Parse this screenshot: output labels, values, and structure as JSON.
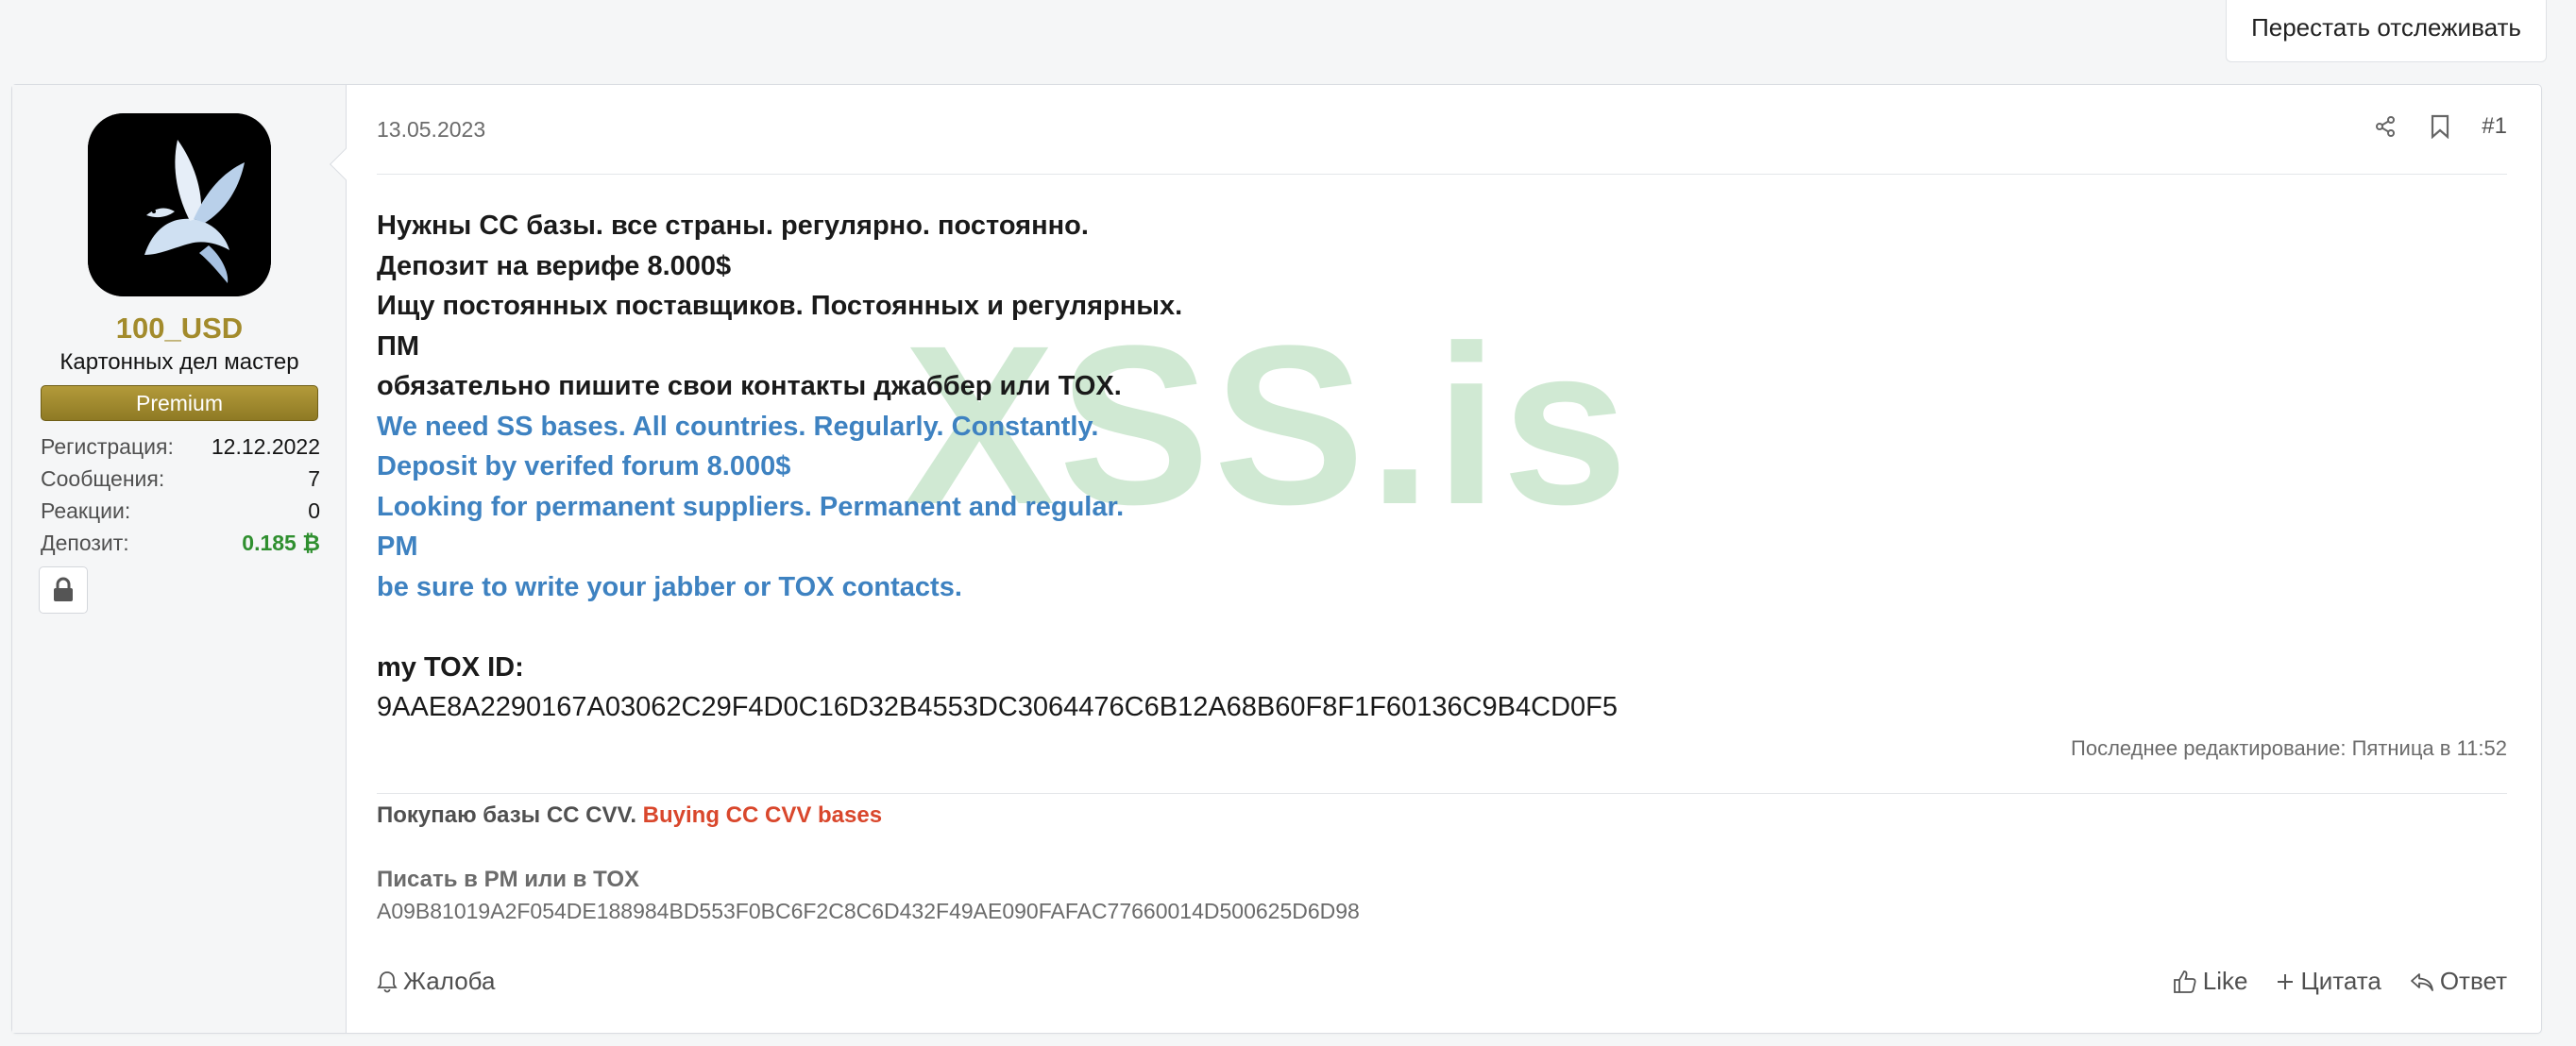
{
  "header": {
    "unwatch_label": "Перестать отслеживать"
  },
  "user": {
    "username": "100_USD",
    "title": "Картонных дел мастер",
    "badge": "Premium",
    "stats": [
      {
        "label": "Регистрация:",
        "value": "12.12.2022"
      },
      {
        "label": "Сообщения:",
        "value": "7"
      },
      {
        "label": "Реакции:",
        "value": "0"
      },
      {
        "label": "Депозит:",
        "value": "0.185 ₿"
      }
    ]
  },
  "post": {
    "date": "13.05.2023",
    "number": "#1",
    "lines_ru": [
      "Нужны СС базы. все страны. регулярно. постоянно.",
      "Депозит на верифе 8.000$",
      "Ищу постоянных поставщиков. Постоянных и регулярных.",
      "ПМ",
      "обязательно пишите свои контакты джаббер или TOX."
    ],
    "lines_en": [
      "We need SS bases. All countries. Regularly. Constantly.",
      "Deposit by verifed forum 8.000$",
      "Looking for permanent suppliers. Permanent and regular.",
      "PM",
      "be sure to write your jabber or TOX contacts."
    ],
    "tox_label": "my TOX ID:",
    "tox_id": "9AAE8A2290167A03062C29F4D0C16D32B4553DC3064476C6B12A68B60F8F1F60136C9B4CD0F5",
    "watermark": "XSS.is",
    "last_edited": "Последнее редактирование: Пятница в 11:52"
  },
  "signature": {
    "line1_ru": "Покупаю базы СС CVV.",
    "line1_en": "Buying CC CVV bases",
    "line2": "Писать в PM или в TOX",
    "line3": "A09B81019A2F054DE188984BD553F0BC6F2C8C6D432F49AE090FAFAC77660014D500625D6D98"
  },
  "footer": {
    "report_label": "Жалоба",
    "like_label": "Like",
    "quote_label": "Цитата",
    "reply_label": "Ответ"
  }
}
